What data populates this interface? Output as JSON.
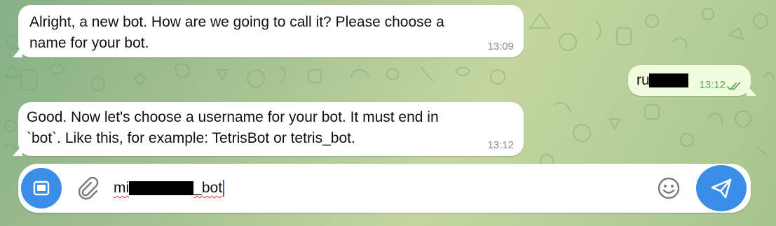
{
  "messages": [
    {
      "direction": "incoming",
      "lines": [
        "Alright, a new bot. How are we going to call it? Please choose a",
        "name for your bot."
      ],
      "time": "13:09"
    },
    {
      "direction": "outgoing",
      "text_visible": "ru",
      "redacted": true,
      "time": "13:12",
      "status": "read"
    },
    {
      "direction": "incoming",
      "lines": [
        "Good. Now let's choose a username for your bot. It must end in",
        "`bot`. Like this, for example: TetrisBot or tetris_bot."
      ],
      "time": "13:12"
    }
  ],
  "composer": {
    "input_prefix": "mi",
    "input_suffix": "_bot",
    "redacted_middle": true,
    "spellcheck_error": true
  },
  "icons": {
    "left_button": "media-square-icon",
    "attach": "paperclip-icon",
    "emoji": "smiley-icon",
    "send": "paper-plane-icon",
    "read_status": "double-check-icon"
  },
  "colors": {
    "accent": "#3a8ee6",
    "incoming_bubble": "#ffffff",
    "outgoing_bubble": "#effdde",
    "outgoing_time": "#5eaa5a",
    "wallpaper": "#a9c493"
  }
}
